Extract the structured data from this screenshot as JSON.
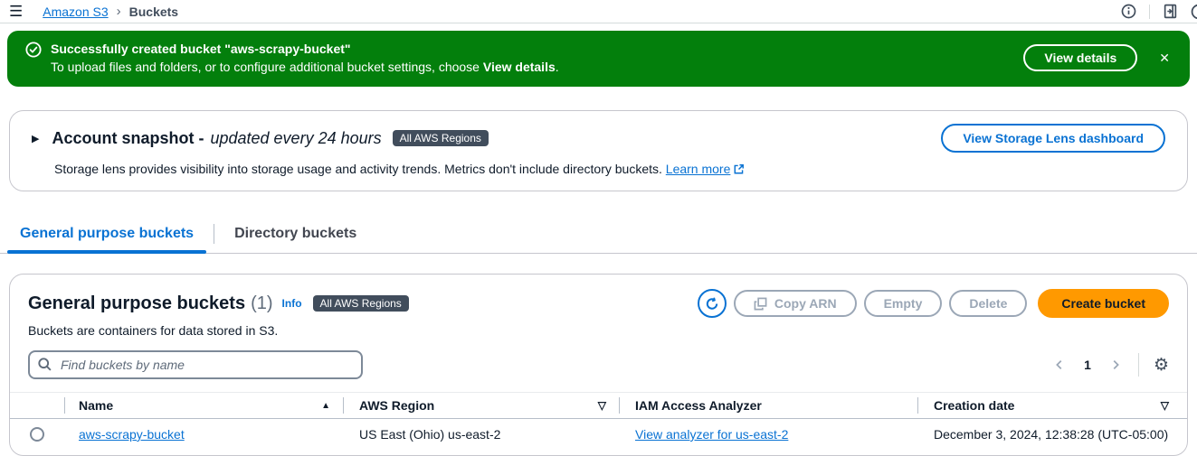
{
  "topbar": {
    "breadcrumb_s3": "Amazon S3",
    "breadcrumb_sep": "›",
    "breadcrumb_current": "Buckets"
  },
  "icons": {
    "hamburger": "☰",
    "caret_right": "▶",
    "sort_asc": "▲",
    "filter": "▽",
    "gear": "⚙",
    "close": "✕"
  },
  "flashbar": {
    "title": "Successfully created bucket \"aws-scrapy-bucket\"",
    "body_prefix": "To upload files and folders, or to configure additional bucket settings, choose ",
    "body_bold": "View details",
    "body_suffix": ".",
    "action_label": "View details"
  },
  "account_snapshot": {
    "title": "Account snapshot -",
    "title_italic": "updated every 24 hours",
    "region_badge": "All AWS Regions",
    "description": "Storage lens provides visibility into storage usage and activity trends. Metrics don't include directory buckets.",
    "learn_more": "Learn more",
    "action_label": "View Storage Lens dashboard"
  },
  "tabs": {
    "general": "General purpose buckets",
    "directory": "Directory buckets"
  },
  "panel": {
    "title": "General purpose buckets",
    "count": "(1)",
    "info_label": "Info",
    "region_badge": "All AWS Regions",
    "description": "Buckets are containers for data stored in S3.",
    "actions": {
      "copy_arn": "Copy ARN",
      "empty": "Empty",
      "delete": "Delete",
      "create": "Create bucket"
    },
    "search_placeholder": "Find buckets by name",
    "pagination_page": "1",
    "table": {
      "headers": {
        "name": "Name",
        "region": "AWS Region",
        "iam": "IAM Access Analyzer",
        "date": "Creation date"
      },
      "rows": [
        {
          "name": "aws-scrapy-bucket",
          "region": "US East (Ohio) us-east-2",
          "iam_link": "View analyzer for us-east-2",
          "date": "December 3, 2024, 12:38:28 (UTC-05:00)"
        }
      ]
    }
  },
  "colors": {
    "success_green": "#037f0c",
    "link_blue": "#0972d3",
    "primary_orange": "#ff9900",
    "badge_dark": "#414d5c"
  }
}
